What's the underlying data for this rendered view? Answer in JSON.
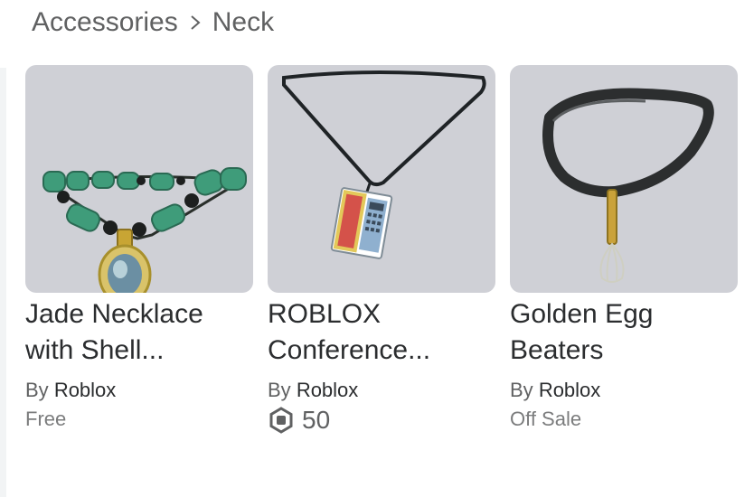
{
  "breadcrumb": {
    "items": [
      "Accessories",
      "Neck"
    ]
  },
  "items": [
    {
      "title": "Jade Necklace with Shell...",
      "by_label": "By",
      "creator": "Roblox",
      "price": "Free",
      "thumbnail_icon": "jade-necklace-image"
    },
    {
      "title": "ROBLOX Conference...",
      "by_label": "By",
      "creator": "Roblox",
      "price": "50",
      "price_icon": "robux-icon",
      "thumbnail_icon": "conference-badge-lanyard-image"
    },
    {
      "title": "Golden Egg Beaters",
      "by_label": "By",
      "creator": "Roblox",
      "price": "Off Sale",
      "thumbnail_icon": "egg-beater-necklace-image"
    }
  ]
}
